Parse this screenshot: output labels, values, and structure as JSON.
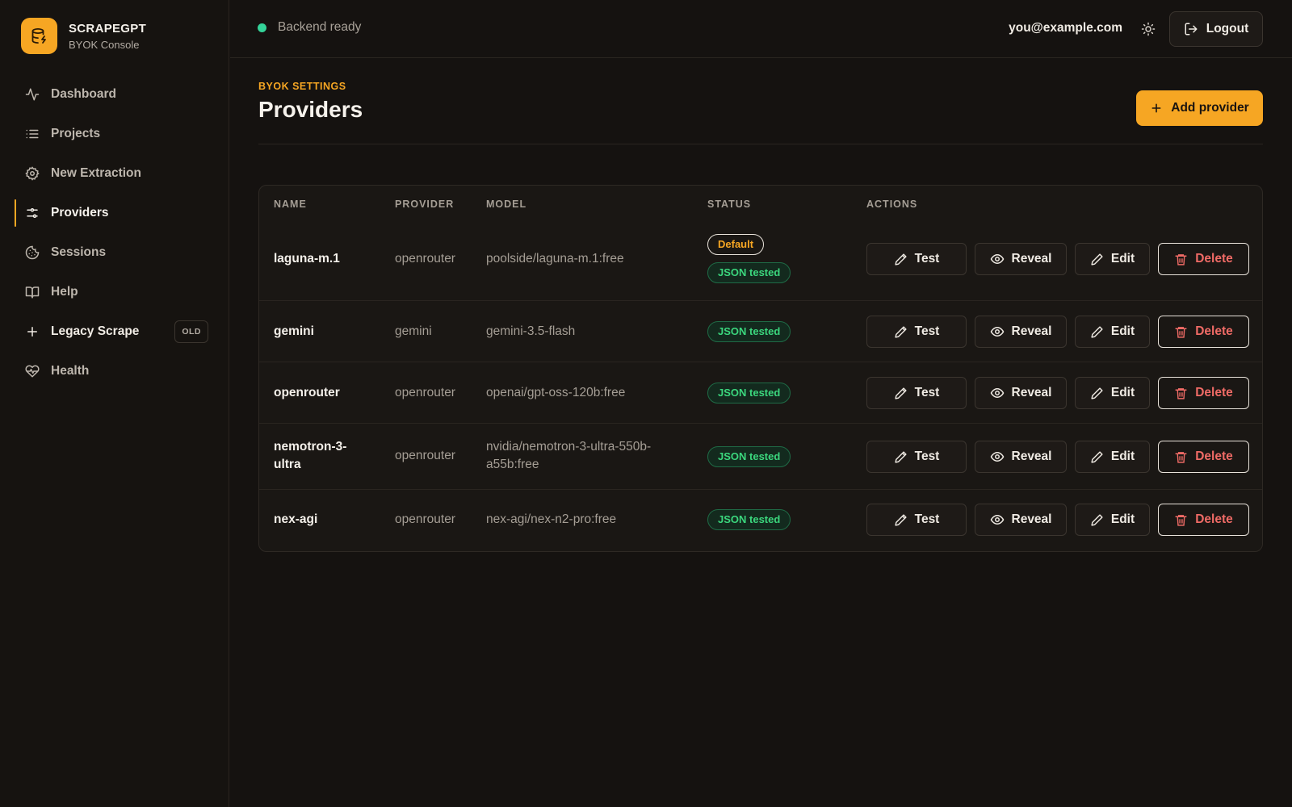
{
  "brand": {
    "name": "SCRAPEGPT",
    "subtitle": "BYOK Console",
    "logo_icon": "database-bolt-icon",
    "accent": "#f6a623"
  },
  "sidebar": {
    "items": [
      {
        "label": "Dashboard",
        "icon": "activity-icon",
        "active": false
      },
      {
        "label": "Projects",
        "icon": "list-icon",
        "active": false
      },
      {
        "label": "New Extraction",
        "icon": "settings-icon",
        "active": false
      },
      {
        "label": "Providers",
        "icon": "sliders-icon",
        "active": true
      },
      {
        "label": "Sessions",
        "icon": "cookie-icon",
        "active": false
      },
      {
        "label": "Help",
        "icon": "book-icon",
        "active": false
      },
      {
        "label": "Legacy Scrape",
        "icon": "plus-icon",
        "active": false,
        "badge": "OLD"
      },
      {
        "label": "Health",
        "icon": "heart-pulse-icon",
        "active": false
      }
    ]
  },
  "topbar": {
    "status_text": "Backend ready",
    "status_color": "#34d399",
    "user_email": "you@example.com",
    "theme_icon": "sun-icon",
    "logout_label": "Logout"
  },
  "page": {
    "eyebrow": "BYOK SETTINGS",
    "title": "Providers",
    "add_label": "Add provider"
  },
  "table": {
    "headers": {
      "name": "NAME",
      "provider": "PROVIDER",
      "model": "MODEL",
      "status": "STATUS",
      "actions": "ACTIONS"
    },
    "action_labels": {
      "test": "Test",
      "reveal": "Reveal",
      "edit": "Edit",
      "delete": "Delete"
    },
    "rows": [
      {
        "name": "laguna-m.1",
        "provider": "openrouter",
        "model": "poolside/laguna-m.1:free",
        "default_badge": "Default",
        "status": "JSON tested"
      },
      {
        "name": "gemini",
        "provider": "gemini",
        "model": "gemini-3.5-flash",
        "status": "JSON tested"
      },
      {
        "name": "openrouter",
        "provider": "openrouter",
        "model": "openai/gpt-oss-120b:free",
        "status": "JSON tested"
      },
      {
        "name": "nemotron-3-ultra",
        "provider": "openrouter",
        "model": "nvidia/nemotron-3-ultra-550b-a55b:free",
        "status": "JSON tested"
      },
      {
        "name": "nex-agi",
        "provider": "openrouter",
        "model": "nex-agi/nex-n2-pro:free",
        "status": "JSON tested"
      }
    ]
  }
}
